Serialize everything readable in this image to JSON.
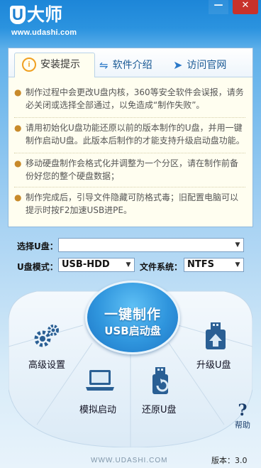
{
  "app": {
    "logo_letter": "U",
    "brand": "大师",
    "url": "www.udashi.com"
  },
  "window": {
    "minimize_glyph": "—",
    "close_glyph": "✕"
  },
  "tabs": [
    {
      "label": "安装提示",
      "icon": "info-icon",
      "active": true
    },
    {
      "label": "软件介绍",
      "icon": "usb-icon",
      "active": false
    },
    {
      "label": "访问官网",
      "icon": "paper-plane-icon",
      "active": false
    }
  ],
  "tips": [
    "制作过程中会更改U盘内核，360等安全软件会误报，请务必关闭或选择全部通过，以免造成“制作失败”。",
    "请用初始化U盘功能还原以前的版本制作的U盘，并用一键制作启动U盘。此版本后制作的才能支持升级启动盘功能。",
    "移动硬盘制作会格式化并调整为一个分区，请在制作前备份好您的整个硬盘数据；",
    "制作完成后，引导文件隐藏可防格式毒；旧配置电脑可以提示时按F2加速USB进PE。"
  ],
  "form": {
    "select_usb_label": "选择U盘：",
    "select_usb_value": "",
    "usb_mode_label": "U盘模式：",
    "usb_mode_value": "USB-HDD",
    "fs_label": "文件系统：",
    "fs_value": "NTFS"
  },
  "actions": {
    "make_line1": "一键制作",
    "make_line2": "USB启动盘",
    "advanced": "高级设置",
    "simulate": "模拟启动",
    "restore": "还原U盘",
    "upgrade": "升级U盘",
    "help": "帮助"
  },
  "footer": {
    "url": "WWW.UDASHI.COM",
    "version": "版本：3.0"
  },
  "colors": {
    "accent": "#2b93df",
    "close": "#c8322b",
    "tips_bg": "#fffef0"
  }
}
